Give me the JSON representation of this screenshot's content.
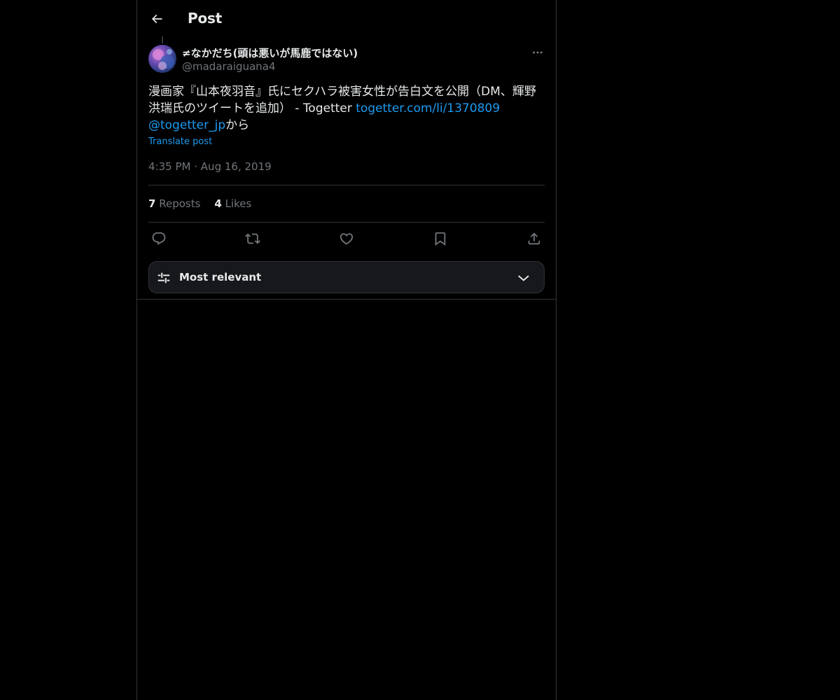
{
  "header": {
    "title": "Post",
    "back_icon": "arrow-left-icon"
  },
  "post": {
    "author": {
      "display_name": "≠なかだち(頭は悪いが馬鹿ではない)",
      "handle": "@madaraiguana4"
    },
    "text": {
      "plain": "漫画家『山本夜羽音』氏にセクハラ被害女性が告白文を公開（DM、輝野洪瑞氏のツイートを追加） - Togetter ",
      "link": "togetter.com/li/1370809",
      "mention": "@togetter_jp",
      "suffix": "から"
    },
    "translate_label": "Translate post",
    "time": "4:35 PM",
    "separator": "·",
    "date": "Aug 16, 2019",
    "stats": {
      "reposts_count": "7",
      "reposts_label": "Reposts",
      "likes_count": "4",
      "likes_label": "Likes"
    },
    "actions": [
      "reply-icon",
      "repost-icon",
      "like-icon",
      "bookmark-icon",
      "share-icon"
    ]
  },
  "replies_sort": {
    "label": "Most relevant",
    "icon": "sliders-icon",
    "chevron": "chevron-down-icon"
  },
  "colors": {
    "background": "#000000",
    "text": "#e7e9ea",
    "secondary": "#71767b",
    "link": "#1d9bf0",
    "border": "#2f3336"
  }
}
